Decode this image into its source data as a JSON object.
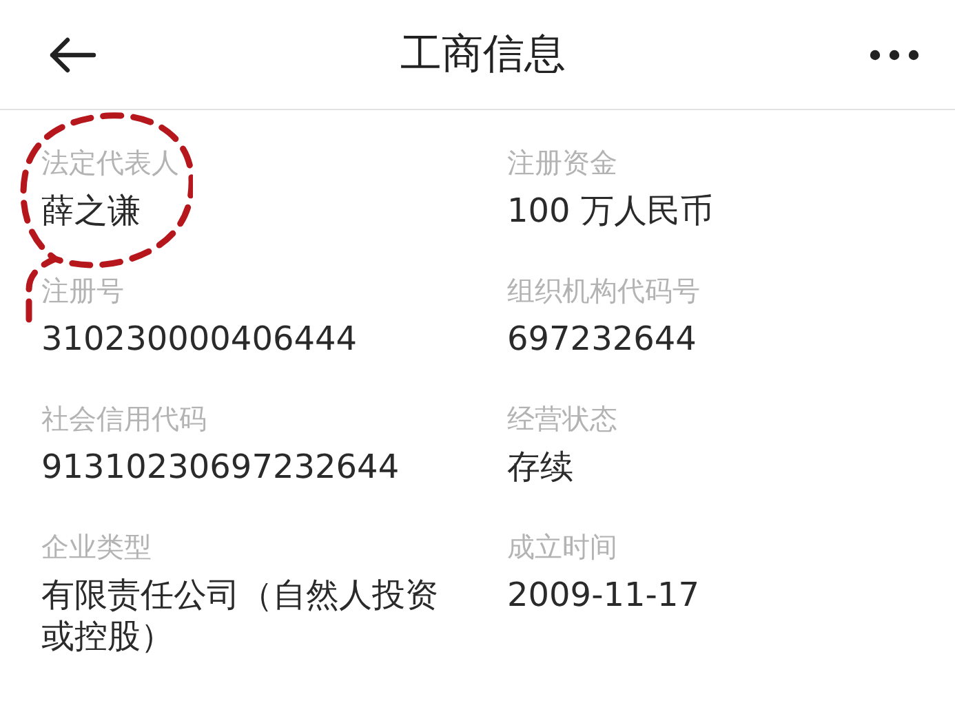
{
  "header": {
    "title": "工商信息"
  },
  "fields": [
    {
      "label": "法定代表人",
      "value": "薛之谦"
    },
    {
      "label": "注册资金",
      "value": "100 万人民币"
    },
    {
      "label": "注册号",
      "value": "310230000406444"
    },
    {
      "label": "组织机构代码号",
      "value": "697232644"
    },
    {
      "label": "社会信用代码",
      "value": "91310230697232644"
    },
    {
      "label": "经营状态",
      "value": "存续"
    },
    {
      "label": "企业类型",
      "value": "有限责任公司（自然人投资或控股）"
    },
    {
      "label": "成立时间",
      "value": "2009-11-17"
    }
  ],
  "annotation": {
    "kind": "dashed-loop"
  }
}
